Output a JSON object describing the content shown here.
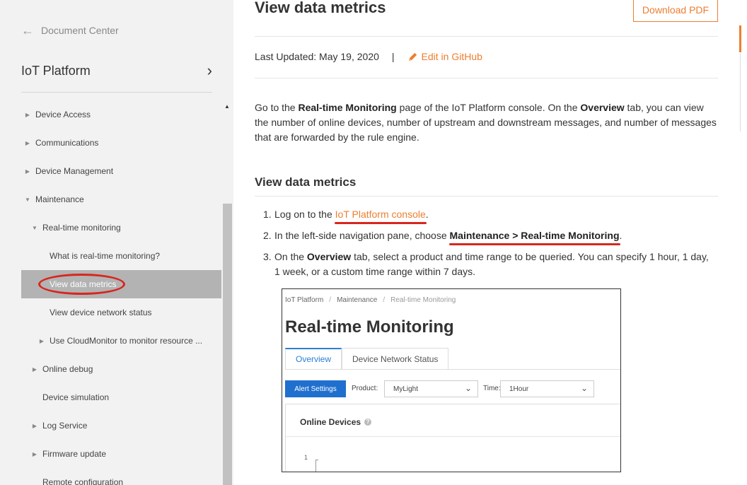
{
  "sidebar": {
    "back_label": "Document Center",
    "product_title": "IoT Platform",
    "items": [
      {
        "label": "Device Access"
      },
      {
        "label": "Communications"
      },
      {
        "label": "Device Management"
      },
      {
        "label": "Maintenance"
      },
      {
        "label": "Real-time monitoring"
      },
      {
        "label": "What is real-time monitoring?"
      },
      {
        "label": "View data metrics"
      },
      {
        "label": "View device network status"
      },
      {
        "label": "Use CloudMonitor to monitor resource ..."
      },
      {
        "label": "Online debug"
      },
      {
        "label": "Device simulation"
      },
      {
        "label": "Log Service"
      },
      {
        "label": "Firmware update"
      },
      {
        "label": "Remote configuration"
      }
    ]
  },
  "header": {
    "title": "View data metrics",
    "download_label": "Download PDF",
    "last_updated": "Last Updated: May 19, 2020",
    "separator": "|",
    "edit_label": "Edit in GitHub"
  },
  "intro": {
    "t1": "Go to the ",
    "b1": "Real-time Monitoring",
    "t2": " page of the IoT Platform console. On the ",
    "b2": "Overview",
    "t3": " tab, you can view the number of online devices, number of upstream and downstream messages, and number of messages that are forwarded by the rule engine."
  },
  "section": {
    "title": "View data metrics"
  },
  "steps": [
    {
      "num": "1.",
      "t1": "Log on to the ",
      "link": "IoT Platform console",
      "t2": "."
    },
    {
      "num": "2.",
      "t1": "In the left-side navigation pane, choose ",
      "b1": "Maintenance > Real-time Monitoring",
      "t2": "."
    },
    {
      "num": "3.",
      "t1": "On the ",
      "b1": "Overview",
      "t2": " tab, select a product and time range to be queried. You can specify 1 hour, 1 day, 1 week, or a custom time range within 7 days."
    }
  ],
  "screenshot": {
    "crumbs": [
      "IoT Platform",
      "Maintenance",
      "Real-time Monitoring"
    ],
    "crumb_sep": "/",
    "title": "Real-time Monitoring",
    "tabs": [
      "Overview",
      "Device Network Status"
    ],
    "alert_button": "Alert Settings",
    "product_label": "Product:",
    "product_value": "MyLight",
    "time_label": "Time:",
    "time_value": "1Hour",
    "card_title": "Online Devices",
    "help_glyph": "?",
    "y_tick": "1"
  },
  "colors": {
    "accent": "#ed7e2f",
    "annotation": "#d8261e",
    "tab_blue": "#2a7fd6",
    "button_blue": "#1f6fce"
  }
}
